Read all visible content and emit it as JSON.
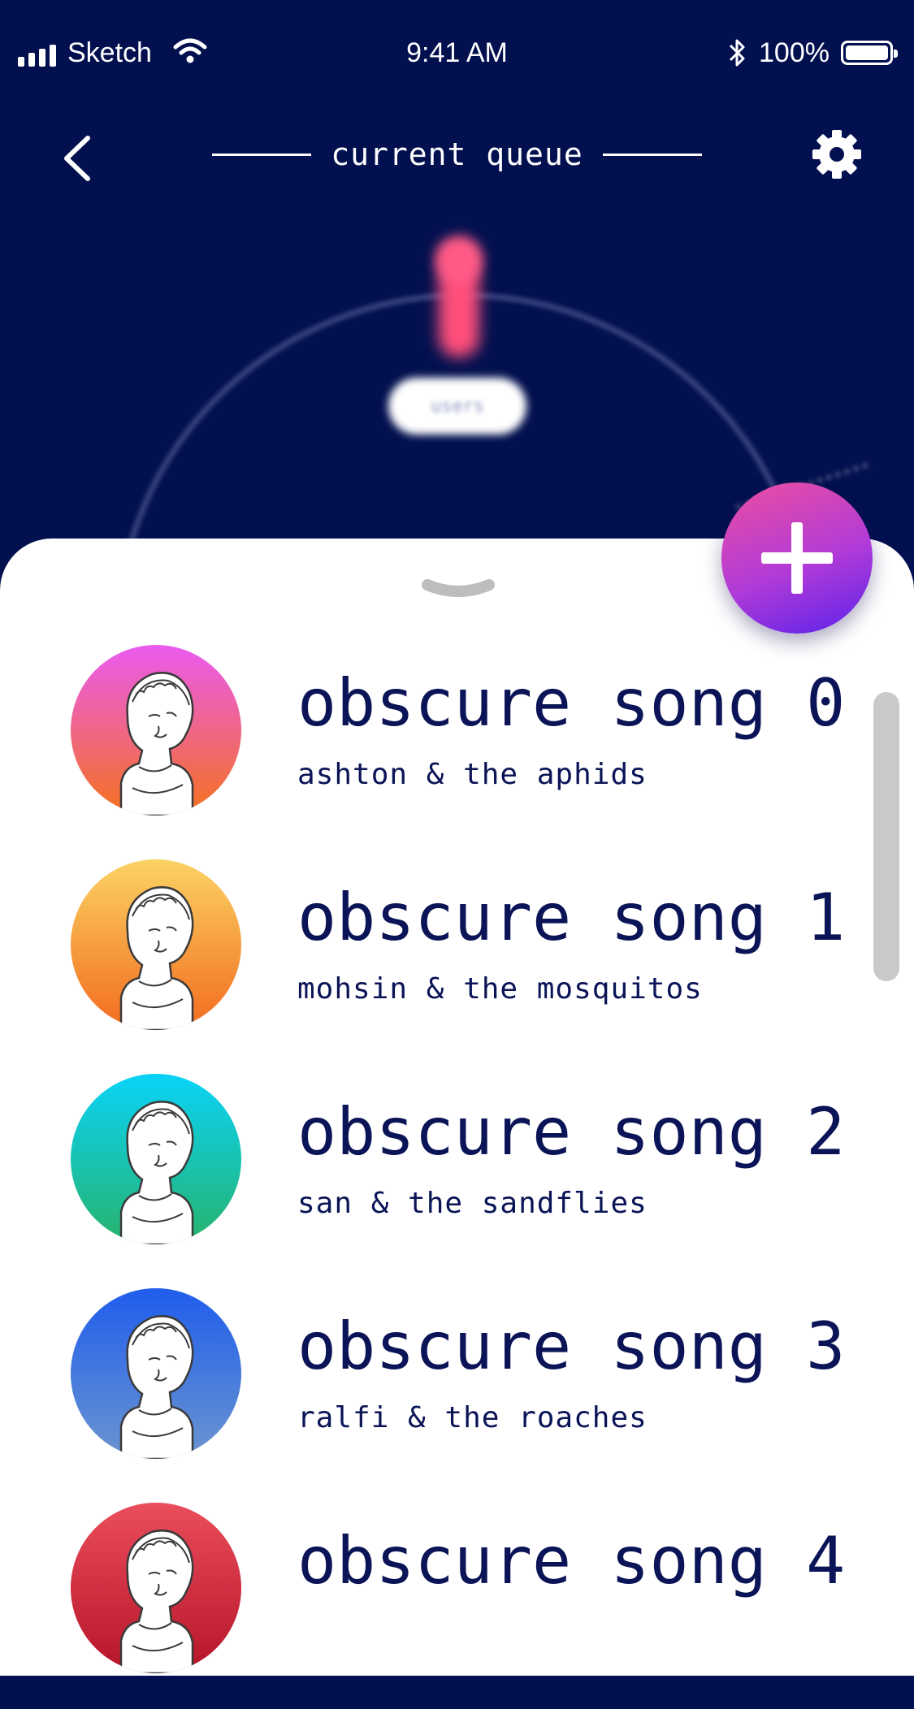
{
  "status_bar": {
    "carrier": "Sketch",
    "time": "9:41 AM",
    "battery_percent": "100%",
    "icons": [
      "signal-icon",
      "wifi-icon",
      "bluetooth-icon",
      "battery-icon"
    ]
  },
  "header": {
    "title": "current queue",
    "back_icon": "chevron-left-icon",
    "settings_icon": "gear-icon"
  },
  "visual": {
    "chip_text": "users"
  },
  "fab": {
    "icon": "plus-icon"
  },
  "queue": [
    {
      "title": "obscure song 0",
      "artist": "ashton & the aphids",
      "art_colors": [
        "#ea5bf0",
        "#f4711e"
      ]
    },
    {
      "title": "obscure song 1",
      "artist": "mohsin & the mosquitos",
      "art_colors": [
        "#fbd364",
        "#f26b1f"
      ]
    },
    {
      "title": "obscure song 2",
      "artist": "san & the sandflies",
      "art_colors": [
        "#0ad3f8",
        "#27b36c"
      ]
    },
    {
      "title": "obscure song 3",
      "artist": "ralfi & the roaches",
      "art_colors": [
        "#1f5ded",
        "#6b95cf"
      ]
    },
    {
      "title": "obscure song 4",
      "artist": "",
      "art_colors": [
        "#ea4d5c",
        "#b51528"
      ]
    }
  ],
  "colors": {
    "background": "#03104f",
    "text": "#0b1457",
    "scrollbar": "#c9c9cc",
    "fab_gradient": [
      "#ec4ea0",
      "#5b22ea"
    ]
  }
}
